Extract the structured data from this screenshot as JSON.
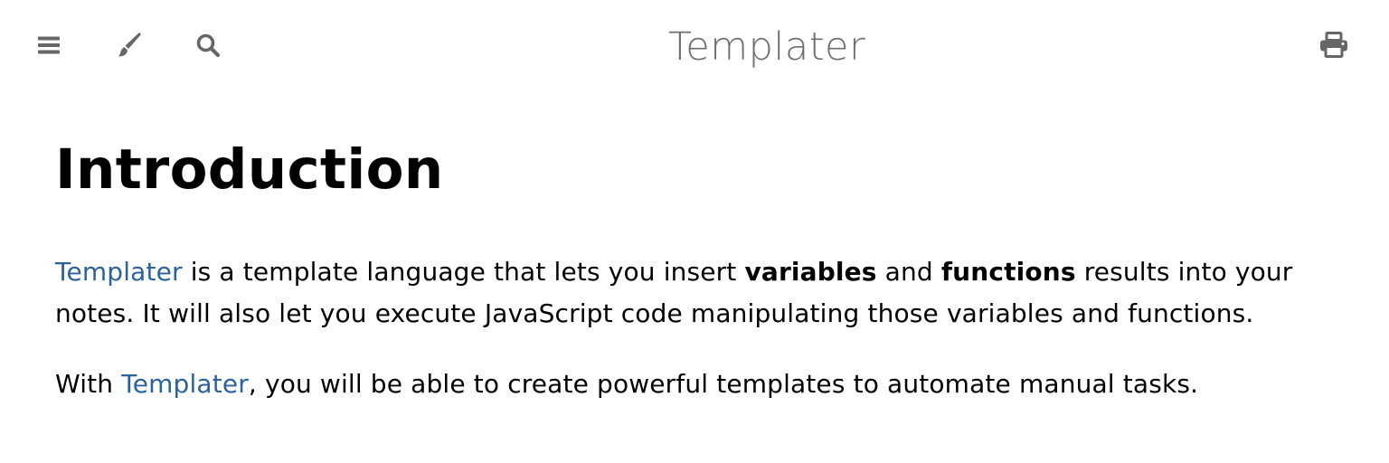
{
  "toolbar": {
    "icons": [
      "menu-icon",
      "paintbrush-icon",
      "search-icon",
      "print-icon"
    ],
    "icon_color": "#666666"
  },
  "header": {
    "title": "Templater"
  },
  "main": {
    "heading": "Introduction",
    "paragraph1": {
      "link_text": "Templater",
      "text1": " is a template language that lets you insert ",
      "bold1": "variables",
      "text2": " and ",
      "bold2": "functions",
      "text3": " results into your notes. It will also let you execute JavaScript code manipulating those variables and functions."
    },
    "paragraph2": {
      "text1": "With ",
      "link_text": "Templater",
      "text2": ", you will be able to create powerful templates to automate manual tasks."
    }
  },
  "colors": {
    "link": "#2b62a0",
    "title": "#6e6e6e",
    "text": "#000000",
    "background": "#ffffff"
  }
}
